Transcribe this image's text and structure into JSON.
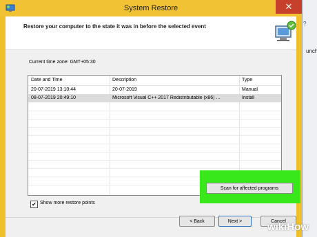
{
  "window": {
    "title": "System Restore",
    "close_glyph": "✕"
  },
  "header": {
    "text": "Restore your computer to the state it was in before the selected event"
  },
  "timezone": {
    "text": "Current time zone: GMT+05:30"
  },
  "table": {
    "columns": [
      "Date and Time",
      "Description",
      "Type"
    ],
    "rows": [
      {
        "date": "20-07-2019 13:10:44",
        "description": "20-07-2019",
        "type": "Manual",
        "selected": false
      },
      {
        "date": "08-07-2019 20:49:10",
        "description": "Microsoft Visual C++ 2017 Redistributable (x86) ...",
        "type": "Install",
        "selected": true
      }
    ]
  },
  "options": {
    "show_more_label": "Show more restore points",
    "show_more_checked": true,
    "check_glyph": "✔"
  },
  "buttons": {
    "scan": "Scan for affected programs",
    "back": "< Back",
    "next": "Next >",
    "cancel": "Cancel"
  },
  "background_window": {
    "partial_text": "unch",
    "partial_link": "?"
  },
  "watermark": {
    "part1": "wiki",
    "part2": "How"
  },
  "colors": {
    "titlebar": "#f1c234",
    "highlight": "#39e81b",
    "close": "#c7402c"
  }
}
